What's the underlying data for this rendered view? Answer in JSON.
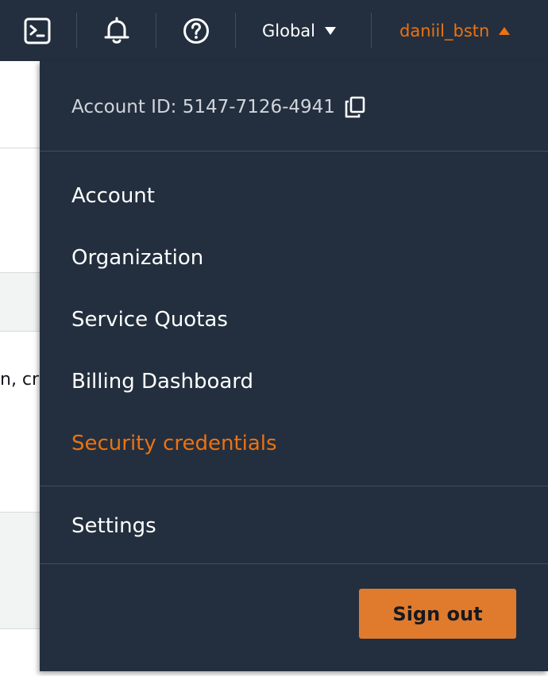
{
  "topbar": {
    "icons": [
      "cloudshell-icon",
      "bell-icon",
      "help-icon"
    ],
    "region": "Global",
    "username": "daniil_bstn",
    "accent": "#ec7211",
    "background": "#232f3e"
  },
  "background_page": {
    "snippet": "n, cr"
  },
  "account_menu": {
    "account_id_label": "Account ID: 5147-7126-4941",
    "items": [
      {
        "label": "Account"
      },
      {
        "label": "Organization"
      },
      {
        "label": "Service Quotas"
      },
      {
        "label": "Billing Dashboard"
      },
      {
        "label": "Security credentials",
        "active": true
      }
    ],
    "settings_label": "Settings",
    "signout_label": "Sign out",
    "signout_color": "#e07b2e"
  }
}
